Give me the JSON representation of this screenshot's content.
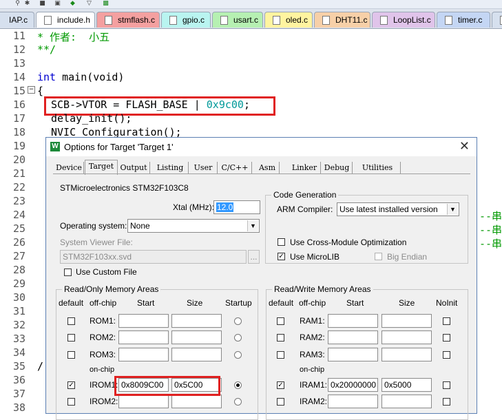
{
  "tabs": [
    {
      "label": "IAP.c",
      "color": "#d6e0ee"
    },
    {
      "label": "include.h",
      "color": "#ffffff"
    },
    {
      "label": "stmflash.c",
      "color": "#f4a0a0"
    },
    {
      "label": "gpio.c",
      "color": "#b9f4f0"
    },
    {
      "label": "usart.c",
      "color": "#b6f0b2"
    },
    {
      "label": "oled.c",
      "color": "#fff4a0"
    },
    {
      "label": "DHT11.c",
      "color": "#f7d0a8"
    },
    {
      "label": "LoopList.c",
      "color": "#e0c4ea"
    },
    {
      "label": "timer.c",
      "color": "#c4d6f4"
    }
  ],
  "editor": {
    "line_numbers": [
      "11",
      "12",
      "13",
      "14",
      "15",
      "16",
      "17",
      "18",
      "19",
      "20",
      "21",
      "22",
      "23",
      "24",
      "25",
      "26",
      "27",
      "28",
      "29",
      "30",
      "31",
      "32",
      "33",
      "34",
      "35",
      "36",
      "37",
      "38"
    ],
    "line11": "* 作者:  小五",
    "line12": "**/",
    "line14_kw": "int",
    "line14_rest": " main(void)",
    "line15": "{",
    "line16_code": "SCB->VTOR = FLASH_BASE | ",
    "line16_num": "0x9c00",
    "line16_end": ";",
    "line17": "delay_init();",
    "line18": "NVIC_Configuration();",
    "line35_frag": "/",
    "right_fragments": [
      "--串",
      "--串",
      "--串"
    ]
  },
  "dialog": {
    "title": "Options for Target 'Target 1'",
    "close": "✕",
    "tabs": [
      "Device",
      "Target",
      "Output",
      "Listing",
      "User",
      "C/C++",
      "Asm",
      "Linker",
      "Debug",
      "Utilities"
    ],
    "active_tab": "Target",
    "device": "STMicroelectronics STM32F103C8",
    "xtal_label": "Xtal (MHz):",
    "xtal_value": "12.0",
    "os_label": "Operating system:",
    "os_value": "None",
    "svf_label": "System Viewer File:",
    "svf_value": "STM32F103xx.svd",
    "svf_browse": "...",
    "custom_file_label": "Use Custom File",
    "codegen": {
      "title": "Code Generation",
      "compiler_label": "ARM Compiler:",
      "compiler_value": "Use latest installed version",
      "cross_module": "Use Cross-Module Optimization",
      "microlib": "Use MicroLIB",
      "big_endian": "Big Endian"
    },
    "ro": {
      "title": "Read/Only Memory Areas",
      "headers": [
        "default",
        "off-chip",
        "Start",
        "Size",
        "Startup"
      ],
      "rows": [
        "ROM1:",
        "ROM2:",
        "ROM3:"
      ],
      "onchip": "on-chip",
      "irom1_label": "IROM1:",
      "irom1_start": "0x8009C00",
      "irom1_size": "0x5C00",
      "irom2_label": "IROM2:"
    },
    "rw": {
      "title": "Read/Write Memory Areas",
      "headers": [
        "default",
        "off-chip",
        "Start",
        "Size",
        "NoInit"
      ],
      "rows": [
        "RAM1:",
        "RAM2:",
        "RAM3:"
      ],
      "onchip": "on-chip",
      "iram1_label": "IRAM1:",
      "iram1_start": "0x20000000",
      "iram1_size": "0x5000",
      "iram2_label": "IRAM2:"
    },
    "check": "✓"
  }
}
